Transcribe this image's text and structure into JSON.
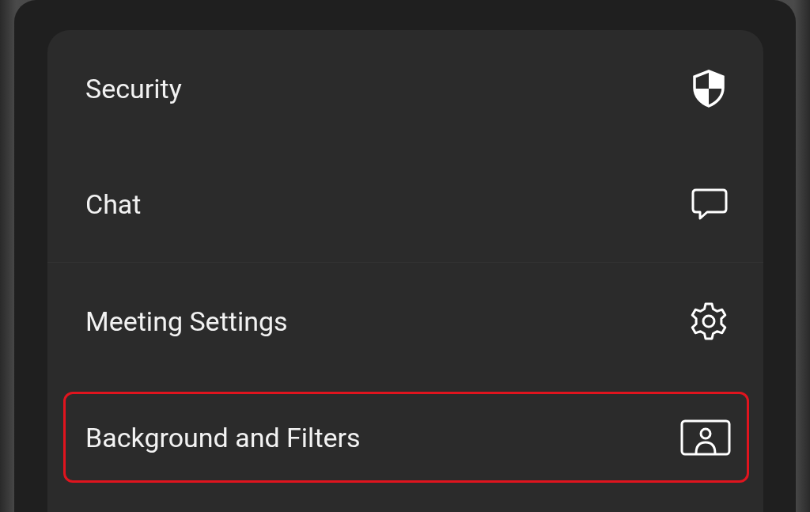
{
  "menu": {
    "items": [
      {
        "label": "Security",
        "kind": "shield",
        "highlighted": false,
        "divider_after": false
      },
      {
        "label": "Chat",
        "kind": "chat",
        "highlighted": false,
        "divider_after": true
      },
      {
        "label": "Meeting Settings",
        "kind": "gear",
        "highlighted": false,
        "divider_after": false
      },
      {
        "label": "Background and Filters",
        "kind": "portrait",
        "highlighted": true,
        "divider_after": false
      }
    ]
  }
}
